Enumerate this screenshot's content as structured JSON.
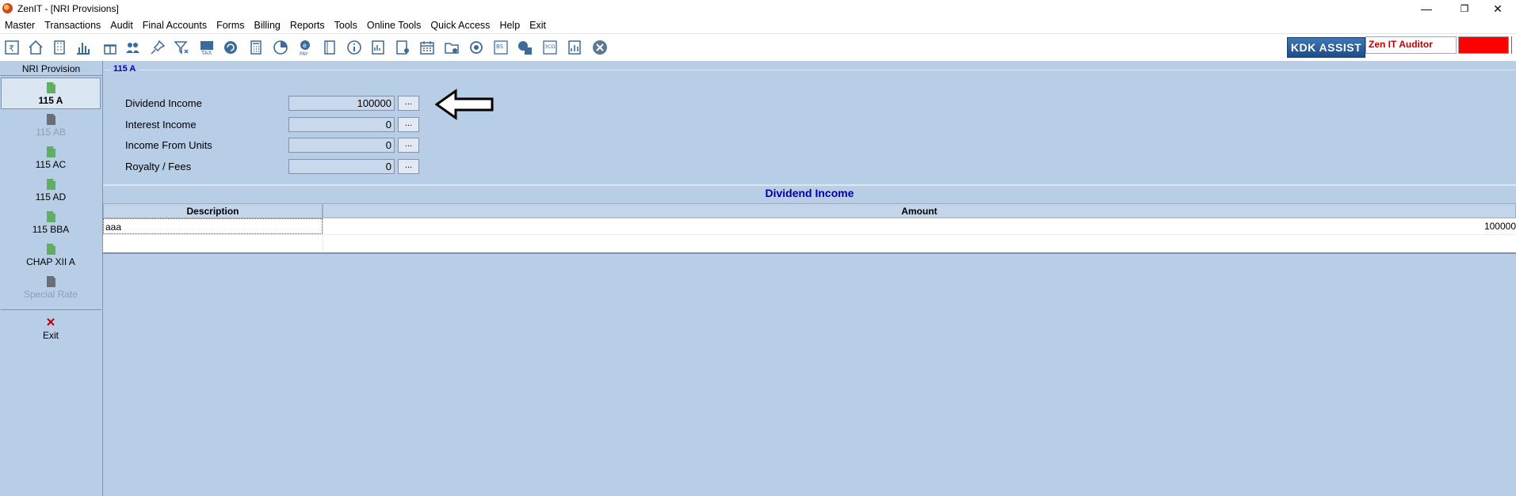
{
  "window": {
    "title": "ZenIT - [NRI Provisions]",
    "minimize": "—",
    "restore": "❐",
    "close": "✕"
  },
  "menu": [
    "Master",
    "Transactions",
    "Audit",
    "Final Accounts",
    "Forms",
    "Billing",
    "Reports",
    "Tools",
    "Online Tools",
    "Quick Access",
    "Help",
    "Exit"
  ],
  "toolbar": {
    "kdk_assist": "KDK ASSIST",
    "auditor": "Zen IT Auditor",
    "indicator_color": "#ff0000"
  },
  "sidebar": {
    "header": "NRI Provision",
    "items": [
      {
        "label": "115 A",
        "state": "active"
      },
      {
        "label": "115 AB",
        "state": "disabled"
      },
      {
        "label": "115 AC",
        "state": "normal"
      },
      {
        "label": "115 AD",
        "state": "normal"
      },
      {
        "label": "115 BBA",
        "state": "normal"
      },
      {
        "label": "CHAP XII A",
        "state": "normal"
      },
      {
        "label": "Special Rate",
        "state": "disabled"
      }
    ],
    "exit": "Exit"
  },
  "main": {
    "section_title": "115 A",
    "fields": [
      {
        "label": "Dividend Income",
        "value": "100000",
        "button": "..."
      },
      {
        "label": "Interest Income",
        "value": "0",
        "button": "..."
      },
      {
        "label": "Income From Units",
        "value": "0",
        "button": "..."
      },
      {
        "label": "Royalty / Fees",
        "value": "0",
        "button": "..."
      }
    ],
    "grid": {
      "title": "Dividend Income",
      "columns": [
        "Description",
        "Amount"
      ],
      "rows": [
        [
          "aaa",
          "100000"
        ]
      ]
    }
  },
  "colors": {
    "panel_bg": "#b8cde6",
    "section_title": "#0000c8",
    "kdk_bg": "#2b5d9b",
    "auditor_text": "#c00000"
  }
}
